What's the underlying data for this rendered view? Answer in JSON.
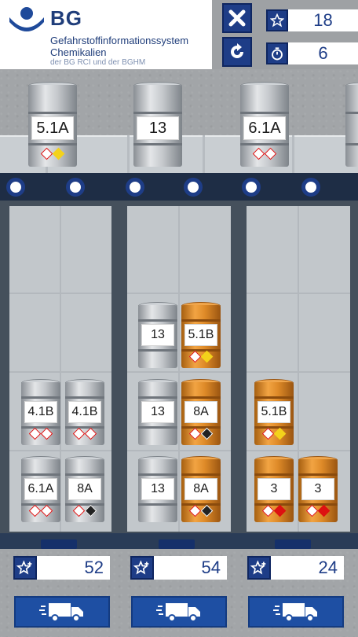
{
  "header": {
    "logo_abbr": "BG",
    "logo_line1": "Gefahrstoffinformationssystem",
    "logo_line2": "Chemikalien",
    "logo_line3": "der BG RCI und der BGHM",
    "close_icon": "close-icon",
    "restart_icon": "restart-icon",
    "stars": "18",
    "time": "6"
  },
  "conveyor": [
    {
      "label": "5.1A",
      "color": "silver"
    },
    {
      "label": "13",
      "color": "silver"
    },
    {
      "label": "6.1A",
      "color": "silver"
    }
  ],
  "shelves": [
    {
      "score": "52",
      "barrels": [
        {
          "label": "4.1B",
          "color": "silver"
        },
        {
          "label": "4.1B",
          "color": "silver"
        },
        {
          "label": "6.1A",
          "color": "silver"
        },
        {
          "label": "8A",
          "color": "silver"
        }
      ]
    },
    {
      "score": "54",
      "barrels": [
        {
          "label": "13",
          "color": "silver"
        },
        {
          "label": "5.1B",
          "color": "orange"
        },
        {
          "label": "13",
          "color": "silver"
        },
        {
          "label": "8A",
          "color": "orange"
        },
        {
          "label": "13",
          "color": "silver"
        },
        {
          "label": "8A",
          "color": "orange"
        }
      ]
    },
    {
      "score": "24",
      "barrels": [
        {
          "label": "5.1B",
          "color": "orange"
        },
        {
          "label": "3",
          "color": "orange"
        },
        {
          "label": "3",
          "color": "orange"
        }
      ]
    }
  ],
  "colors": {
    "accent_blue": "#1e3d87",
    "truck_blue": "#1e4fa3",
    "barrel_orange": "#e3902f",
    "barrel_silver": "#c5c8cc"
  }
}
